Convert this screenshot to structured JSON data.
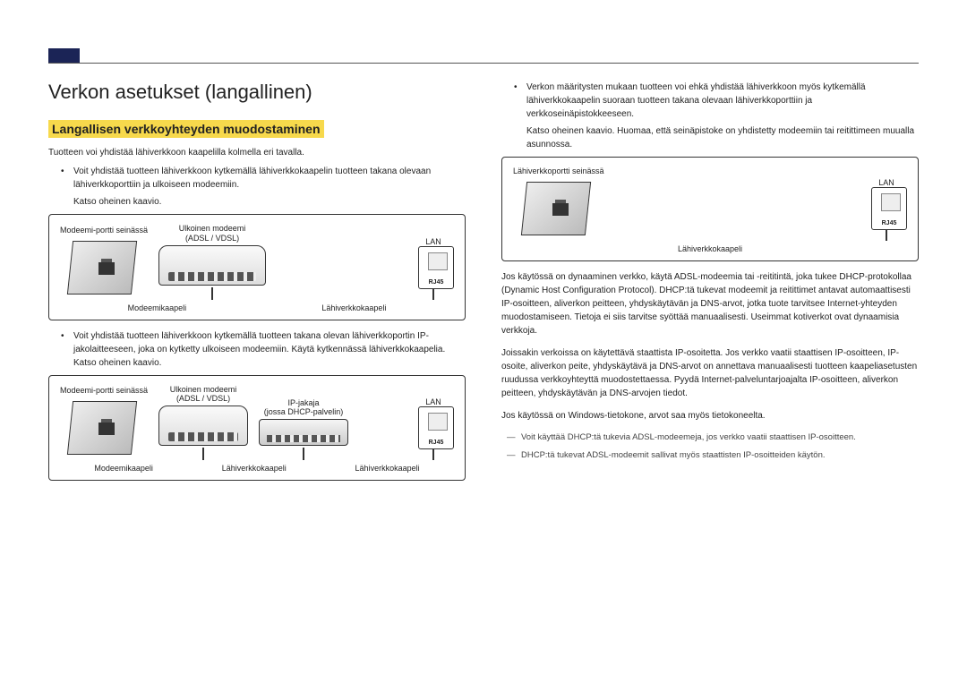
{
  "page": {
    "title": "Verkon asetukset (langallinen)",
    "section": "Langallisen verkkoyhteyden muodostaminen"
  },
  "left": {
    "intro": "Tuotteen voi yhdistää lähiverkkoon kaapelilla kolmella eri tavalla.",
    "bullet1_main": "Voit yhdistää tuotteen lähiverkkoon kytkemällä lähiverkkokaapelin tuotteen takana olevaan lähiverkkoporttiin ja ulkoiseen modeemiin.",
    "bullet1_sub": "Katso oheinen kaavio.",
    "bullet2": "Voit yhdistää tuotteen lähiverkkoon kytkemällä tuotteen takana olevan lähiverkkoportin IP-jakolaitteeseen, joka on kytketty ulkoiseen modeemiin. Käytä kytkennässä lähiverkkokaapelia. Katso oheinen kaavio."
  },
  "diag_labels": {
    "wall": "Modeemi-portti seinässä",
    "ext_modem": "Ulkoinen modeemi",
    "adsl": "(ADSL / VDSL)",
    "ip_splitter": "IP-jakaja",
    "dhcp": "(jossa DHCP-palvelin)",
    "lan": "LAN",
    "rj45": "RJ45",
    "modem_cable": "Modeemikaapeli",
    "lan_cable": "Lähiverkkokaapeli",
    "wall_port": "Lähiverkkoportti seinässä"
  },
  "right": {
    "bullet": "Verkon määritysten mukaan tuotteen voi ehkä yhdistää lähiverkkoon myös kytkemällä lähiverkkokaapelin suoraan tuotteen takana olevaan lähiverkkoporttiin ja verkkoseinäpistokkeeseen.",
    "bullet_sub": "Katso oheinen kaavio. Huomaa, että seinäpistoke on yhdistetty modeemiin tai reitittimeen muualla asunnossa.",
    "p_dhcp": "Jos käytössä on dynaaminen verkko, käytä ADSL-modeemia tai -reititintä, joka tukee DHCP-protokollaa (Dynamic Host Configuration Protocol). DHCP:tä tukevat modeemit ja reitittimet antavat automaattisesti IP-osoitteen, aliverkon peitteen, yhdyskäytävän ja DNS-arvot, jotka tuote tarvitsee Internet-yhteyden muodostamiseen. Tietoja ei siis tarvitse syöttää manuaalisesti. Useimmat kotiverkot ovat dynaamisia verkkoja.",
    "p_static": "Joissakin verkoissa on käytettävä staattista IP-osoitetta. Jos verkko vaatii staattisen IP-osoitteen, IP-osoite, aliverkon peite, yhdyskäytävä ja DNS-arvot on annettava manuaalisesti tuotteen kaapeliasetusten ruudussa verkkoyhteyttä muodostettaessa. Pyydä Internet-palveluntarjoajalta IP-osoitteen, aliverkon peitteen, yhdyskäytävän ja DNS-arvojen tiedot.",
    "p_win": "Jos käytössä on Windows-tietokone, arvot saa myös tietokoneelta.",
    "dash1": "Voit käyttää DHCP:tä tukevia ADSL-modeemeja, jos verkko vaatii staattisen IP-osoitteen.",
    "dash2": "DHCP:tä tukevat ADSL-modeemit sallivat myös staattisten IP-osoitteiden käytön."
  }
}
